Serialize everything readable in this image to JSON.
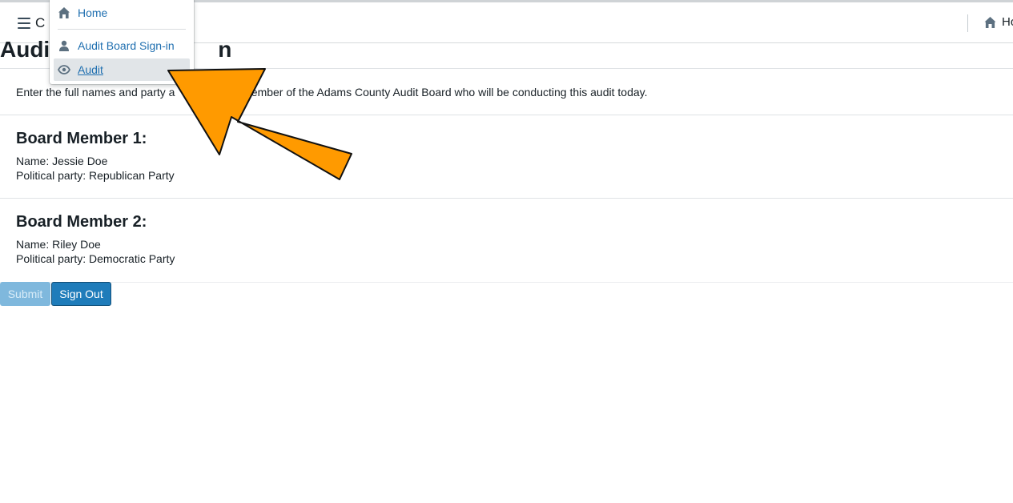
{
  "navbar": {
    "title_partial": "C",
    "right_label_partial": "Ho"
  },
  "dropdown": {
    "items": [
      {
        "label": "Home",
        "icon": "home-icon"
      },
      {
        "label": "Audit Board Sign-in",
        "icon": "user-icon"
      },
      {
        "label": "Audit",
        "icon": "eye-icon",
        "active": true
      }
    ]
  },
  "page": {
    "title_visible_start": "Audi",
    "title_visible_end": "n",
    "intro_visible_start": "Enter the full names and party a",
    "intro_visible_end": "ch member of the Adams County Audit Board who will be conducting this audit today."
  },
  "board_members": [
    {
      "heading": "Board Member 1:",
      "name_line": "Name: Jessie Doe",
      "party_line": "Political party: Republican Party"
    },
    {
      "heading": "Board Member 2:",
      "name_line": "Name: Riley Doe",
      "party_line": "Political party: Democratic Party"
    }
  ],
  "buttons": {
    "submit_label": "Submit",
    "signout_label": "Sign Out"
  },
  "colors": {
    "accent": "#1f7cba",
    "link": "#1f6fb0",
    "annotation_arrow": "#ff9a00"
  }
}
